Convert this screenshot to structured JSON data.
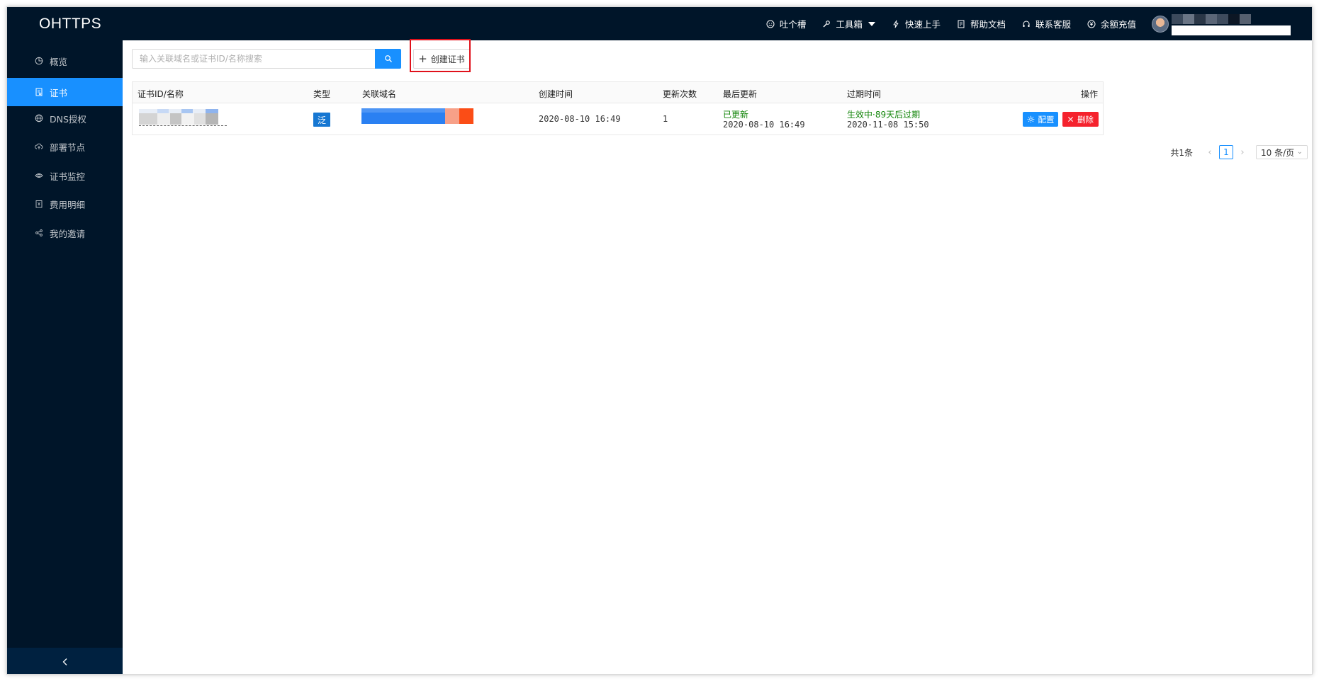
{
  "header": {
    "logo": "OHTTPS",
    "nav": [
      {
        "label": "吐个槽",
        "icon": "smile-icon"
      },
      {
        "label": "工具箱",
        "icon": "tool-icon",
        "dropdown": true
      },
      {
        "label": "快速上手",
        "icon": "bolt-icon"
      },
      {
        "label": "帮助文档",
        "icon": "doc-icon"
      },
      {
        "label": "联系客服",
        "icon": "headset-icon"
      },
      {
        "label": "余额充值",
        "icon": "yen-icon"
      }
    ]
  },
  "sidebar": {
    "items": [
      {
        "label": "概览",
        "icon": "pie-chart-icon"
      },
      {
        "label": "证书",
        "icon": "certificate-icon",
        "active": true
      },
      {
        "label": "DNS授权",
        "icon": "globe-icon"
      },
      {
        "label": "部署节点",
        "icon": "cloud-upload-icon"
      },
      {
        "label": "证书监控",
        "icon": "eye-icon"
      },
      {
        "label": "费用明细",
        "icon": "bill-icon"
      },
      {
        "label": "我的邀请",
        "icon": "share-icon"
      }
    ],
    "collapse_glyph": "<"
  },
  "toolbar": {
    "search_placeholder": "输入关联域名或证书ID/名称搜索",
    "create_label": "创建证书"
  },
  "table": {
    "columns": [
      "证书ID/名称",
      "类型",
      "关联域名",
      "创建时间",
      "更新次数",
      "最后更新",
      "过期时间",
      "操作"
    ],
    "rows": [
      {
        "type": "泛",
        "created": "2020-08-10 16:49",
        "renew_count": "1",
        "last_update_status": "已更新",
        "last_update_time": "2020-08-10 16:49",
        "expire_status": "生效中·89天后过期",
        "expire_time": "2020-11-08 15:50",
        "config_label": "配置",
        "delete_label": "删除"
      }
    ]
  },
  "pagination": {
    "total": "共1条",
    "current": "1",
    "page_size": "10 条/页"
  },
  "colors": {
    "header_bg": "#001529",
    "primary": "#1890ff",
    "danger": "#f5222d",
    "success": "#13850a",
    "highlight_box": "#e0111b"
  }
}
